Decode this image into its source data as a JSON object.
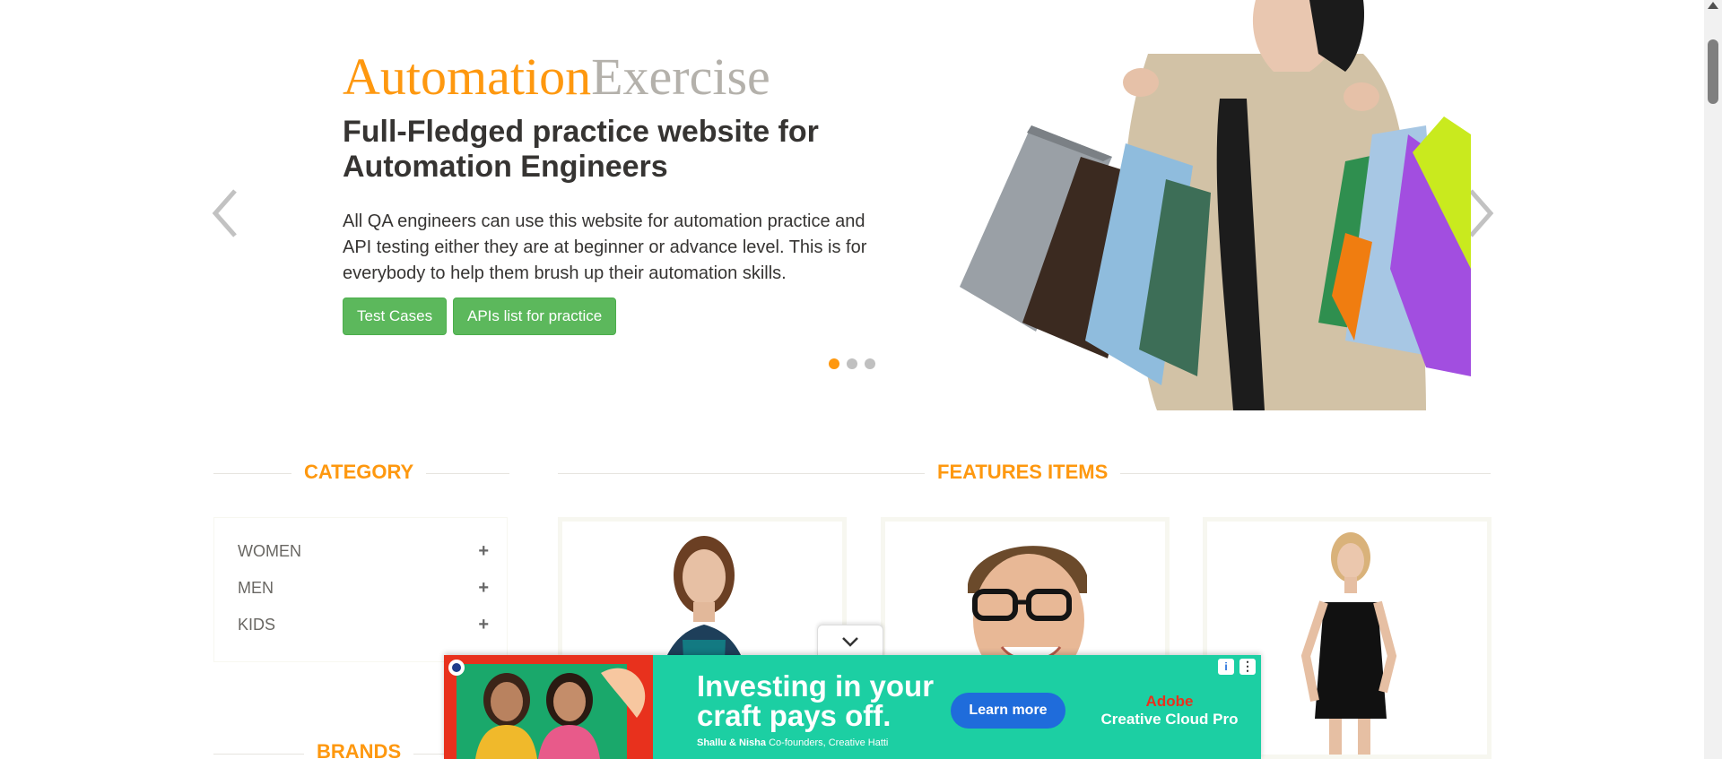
{
  "hero": {
    "brand_part1": "Automation",
    "brand_part2": "Exercise",
    "headline": "Full-Fledged practice website for Automation Engineers",
    "description": "All QA engineers can use this website for automation practice and API testing either they are at beginner or advance level. This is for everybody to help them brush up their automation skills.",
    "buttons": {
      "test_cases": "Test Cases",
      "apis_list": "APIs list for practice"
    },
    "slides_count": 3,
    "active_slide": 1,
    "image": "woman-with-shopping-bags"
  },
  "category": {
    "title": "Category",
    "items": [
      {
        "label": "Women",
        "icon": "plus-icon"
      },
      {
        "label": "Men",
        "icon": "plus-icon"
      },
      {
        "label": "Kids",
        "icon": "plus-icon"
      }
    ]
  },
  "brands": {
    "title": "Brands"
  },
  "features": {
    "title": "Features Items",
    "products": [
      {
        "image": "woman-in-teal-top"
      },
      {
        "image": "man-with-glasses"
      },
      {
        "image": "woman-in-black-dress"
      }
    ]
  },
  "ad": {
    "headline": "Investing in your craft pays off.",
    "credit_names": "Shallu & Nisha",
    "credit_role": "Co-founders, Creative Hatti",
    "cta": "Learn more",
    "brand": "Adobe",
    "product": "Creative Cloud Pro",
    "info_icon": "i",
    "menu_icon": "⋮"
  },
  "colors": {
    "accent": "#fe980f",
    "button_green": "#5cb85c",
    "ad_teal": "#1ccfa3",
    "ad_blue": "#1f6cdb",
    "adobe_red": "#e8311d"
  }
}
